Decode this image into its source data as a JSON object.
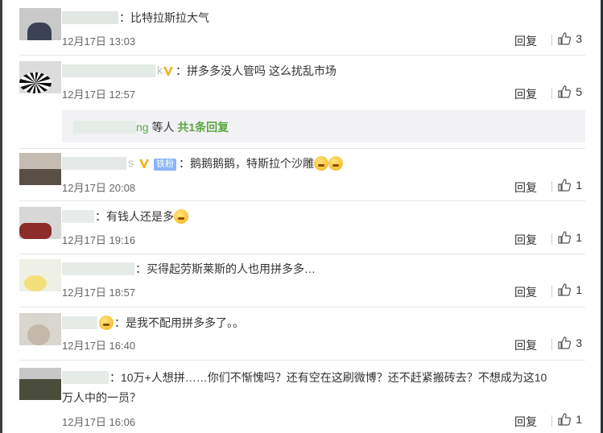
{
  "comments": [
    {
      "user_suffix": "",
      "text": "比特拉斯拉大气",
      "time": "12月17日 13:03",
      "likes": "3"
    },
    {
      "user_suffix": "k",
      "text": "拼多多没人管吗 这么扰乱市场",
      "time": "12月17日 12:57",
      "likes": "5",
      "subreply": {
        "user_suffix": "ng",
        "mid": " 等人 ",
        "count_text": "共1条回复"
      }
    },
    {
      "user_suffix": "s",
      "badge": "铁粉",
      "text": "鹅鹅鹅鹅，特斯拉个沙雕",
      "time": "12月17日 20:08",
      "likes": "1"
    },
    {
      "user_suffix": "",
      "text": "有钱人还是多",
      "time": "12月17日 19:16",
      "likes": "1"
    },
    {
      "user_suffix": "",
      "text": "买得起劳斯莱斯的人也用拼多多…",
      "time": "12月17日 18:57",
      "likes": "1"
    },
    {
      "user_suffix": "",
      "text": "是我不配用拼多多了。。",
      "time": "12月17日 16:40",
      "likes": "3"
    },
    {
      "user_suffix": "",
      "text": "10万+人想拼……你们不惭愧吗？还有空在这刷微博？还不赶紧搬砖去？不想成为这10",
      "text2": "万人中的一员？",
      "time": "12月17日 16:06",
      "likes": "1"
    }
  ],
  "labels": {
    "reply": "回复",
    "colon": "："
  },
  "icons": {
    "verified": "verified-v-icon",
    "like": "thumbs-up-icon",
    "emoji": "emoji-icon"
  }
}
